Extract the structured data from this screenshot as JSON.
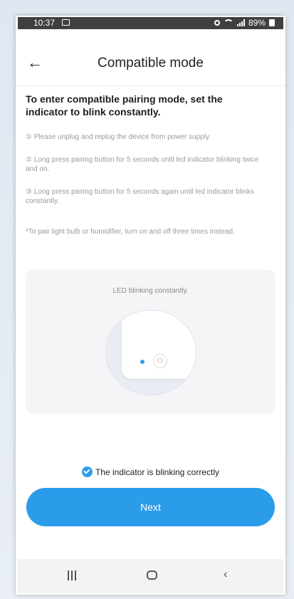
{
  "status": {
    "time": "10:37",
    "battery": "89%"
  },
  "header": {
    "title": "Compatible mode"
  },
  "heading": "To enter compatible pairing mode, set the indicator to blink constantly.",
  "steps": [
    "① Please unplug and replug the device from power supply.",
    "② Long press pairing button for 5 seconds until led indicator blinking twice and on.",
    "③ Long press pairing button for 5 seconds again until led indicator blinks constantly."
  ],
  "note": "*To pair light bulb or humidifier, turn on and off three times instead.",
  "diagram": {
    "caption": "LED blinking constantly."
  },
  "confirm": {
    "label": "The indicator is blinking correctly",
    "checked": true
  },
  "next_label": "Next",
  "colors": {
    "accent": "#2b9cea"
  }
}
